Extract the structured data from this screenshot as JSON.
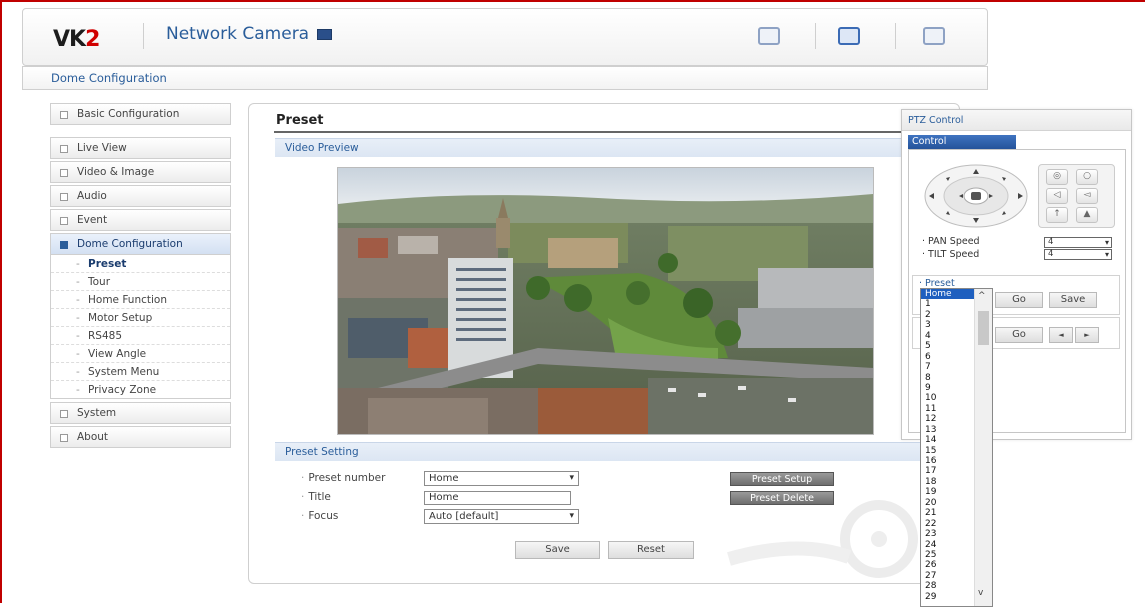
{
  "header": {
    "logo_main": "VK",
    "logo_accent": "2",
    "app_title": "Network Camera"
  },
  "breadcrumb": "Dome Configuration",
  "sidebar": {
    "items": [
      {
        "label": "Basic Configuration"
      },
      {
        "label": "Live View"
      },
      {
        "label": "Video & Image"
      },
      {
        "label": "Audio"
      },
      {
        "label": "Event"
      },
      {
        "label": "Dome Configuration"
      },
      {
        "label": "System"
      },
      {
        "label": "About"
      }
    ],
    "sub_items": [
      {
        "label": "Preset"
      },
      {
        "label": "Tour"
      },
      {
        "label": "Home Function"
      },
      {
        "label": "Motor Setup"
      },
      {
        "label": "RS485"
      },
      {
        "label": "View Angle"
      },
      {
        "label": "System Menu"
      },
      {
        "label": "Privacy Zone"
      }
    ]
  },
  "main": {
    "title": "Preset",
    "video_section": "Video Preview",
    "setting_section": "Preset Setting",
    "fields": {
      "preset_number_label": "Preset number",
      "preset_number_value": "Home",
      "title_label": "Title",
      "title_value": "Home",
      "focus_label": "Focus",
      "focus_value": "Auto  [default]"
    },
    "buttons": {
      "preset_setup": "Preset Setup",
      "preset_delete": "Preset Delete",
      "save": "Save",
      "reset": "Reset"
    }
  },
  "ptz": {
    "title": "PTZ Control",
    "tab": "Control",
    "pan_label": "PAN Speed",
    "pan_value": "4",
    "tilt_label": "TILT Speed",
    "tilt_value": "4",
    "preset_label": "Preset",
    "preset_value": "Home",
    "go_label": "Go",
    "save_label": "Save",
    "go2_label": "Go",
    "prev_glyph": "◄",
    "next_glyph": "►"
  },
  "preset_dropdown": {
    "options": [
      "Home",
      "1",
      "2",
      "3",
      "4",
      "5",
      "6",
      "7",
      "8",
      "9",
      "10",
      "11",
      "12",
      "13",
      "14",
      "15",
      "16",
      "17",
      "18",
      "19",
      "20",
      "21",
      "22",
      "23",
      "24",
      "25",
      "26",
      "27",
      "28",
      "29"
    ],
    "selected": "Home"
  },
  "colors": {
    "accent": "#2a5d9a",
    "frame": "#c00000",
    "highlight": "#1e5fbf"
  }
}
